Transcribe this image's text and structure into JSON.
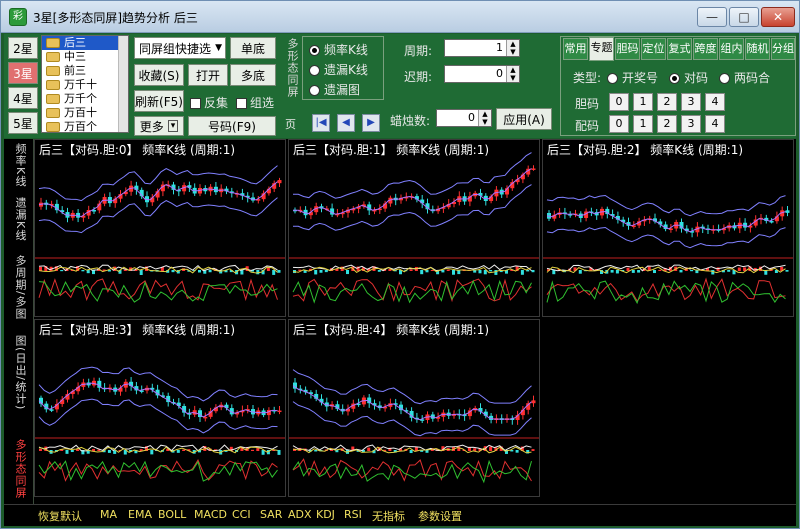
{
  "window": {
    "title": "3星[多形态同屏]趋势分析 后三",
    "logo": "彩",
    "min": "—",
    "max": "□",
    "close": "✕"
  },
  "star_buttons": [
    "2星",
    "3星",
    "4星",
    "5星"
  ],
  "selected_star": 1,
  "type_list": [
    "后三",
    "中三",
    "前三",
    "万千十",
    "万千个",
    "万百十",
    "万百个"
  ],
  "selected_type": 0,
  "controls": {
    "sync_select": "同屏组快捷选",
    "single_bottom": "单底",
    "favorite": "收藏(S)",
    "open": "打开",
    "multi_bottom": "多底",
    "refresh": "刷新(F5)",
    "reverse_label": "反集",
    "group_label": "组选",
    "more": "更多",
    "number": "号码(F9)"
  },
  "vertical_label_top": "多形态同屏",
  "page_label": "页",
  "chart_mode": {
    "options": [
      "频率K线",
      "遗漏K线",
      "遗漏图"
    ],
    "selected": 0
  },
  "params": {
    "period_label": "周期:",
    "period_value": "1",
    "lag_label": "迟期:",
    "lag_value": "0",
    "count_label": "蜡烛数:",
    "count_value": "0",
    "apply": "应用(A)"
  },
  "tabs": [
    "常用",
    "专题",
    "胆码",
    "定位",
    "复式",
    "跨度",
    "组内",
    "随机",
    "分组"
  ],
  "selected_tab": 1,
  "kind": {
    "label": "类型:",
    "options": [
      "开奖号",
      "对码",
      "两码合"
    ],
    "selected": 1
  },
  "dan_label": "胆码",
  "dan_values": [
    "0",
    "1",
    "2",
    "3",
    "4"
  ],
  "pei_label": "配码",
  "pei_values": [
    "0",
    "1",
    "2",
    "3",
    "4"
  ],
  "side_labels": [
    "频率K线",
    "遗漏K线",
    "多周期/多图",
    "图(日出/统计)"
  ],
  "side_active": "多形态同屏",
  "panels": [
    {
      "title": "后三【对码.胆:0】 频率K线 (周期:1)"
    },
    {
      "title": "后三【对码.胆:1】 频率K线 (周期:1)"
    },
    {
      "title": "后三【对码.胆:2】 频率K线 (周期:1)"
    },
    {
      "title": "后三【对码.胆:3】 频率K线 (周期:1)"
    },
    {
      "title": "后三【对码.胆:4】 频率K线 (周期:1)"
    }
  ],
  "indicators": [
    "恢复默认",
    "MA",
    "EMA",
    "BOLL",
    "MACD",
    "CCI",
    "SAR",
    "ADX",
    "KDJ",
    "RSI",
    "无指标",
    "参数设置"
  ],
  "colors": {
    "up": "#ff3030",
    "down": "#30e0e0",
    "band": "#8080ff",
    "indicator_yellow": "#f0e060"
  }
}
